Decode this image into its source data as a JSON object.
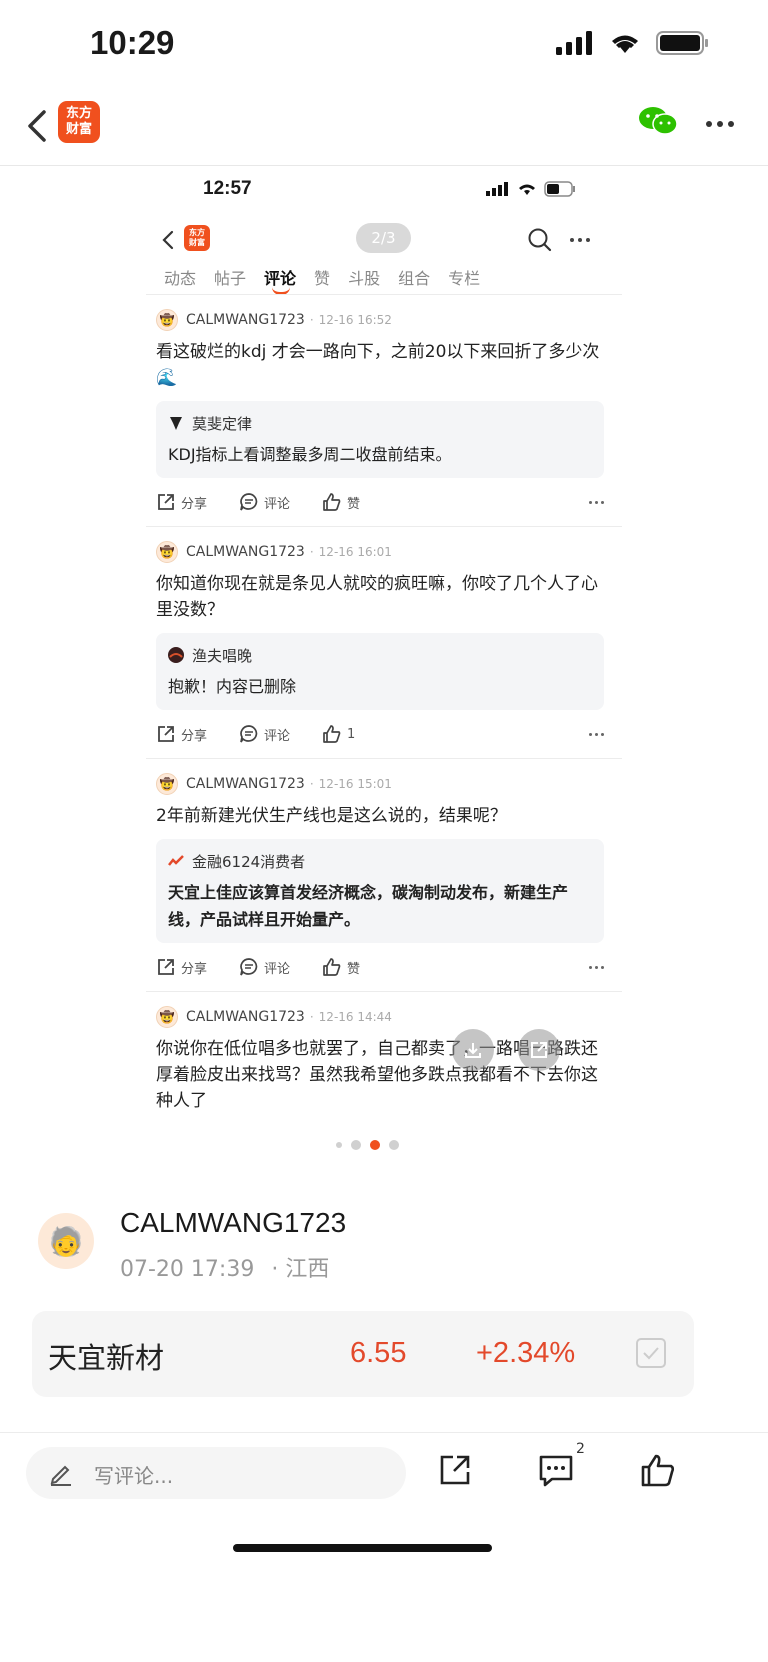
{
  "status_bar": {
    "time": "10:29"
  },
  "nav": {
    "logo_text": "东方\n财富"
  },
  "screenshot": {
    "status_time": "12:57",
    "page_indicator": "2/3",
    "tabs": [
      "动态",
      "帖子",
      "评论",
      "赞",
      "斗股",
      "组合",
      "专栏"
    ],
    "active_tab": "评论",
    "posts": [
      {
        "user": "CALMWANG1723",
        "time": "12-16 16:52",
        "text": "看这破烂的kdj 才会一路向下，之前20以下来回折了多少次🌊",
        "quote_user": "莫斐定律",
        "quote_text": "KDJ指标上看调整最多周二收盘前结束。",
        "share": "分享",
        "comment": "评论",
        "like": "赞"
      },
      {
        "user": "CALMWANG1723",
        "time": "12-16 16:01",
        "text": "你知道你现在就是条见人就咬的疯旺嘛，你咬了几个人了心里没数？",
        "quote_user": "渔夫唱晚",
        "quote_text": "抱歉！内容已删除",
        "share": "分享",
        "comment": "评论",
        "like": "1"
      },
      {
        "user": "CALMWANG1723",
        "time": "12-16 15:01",
        "text": "2年前新建光伏生产线也是这么说的，结果呢？",
        "quote_user": "金融6124消费者",
        "quote_text": "天宜上佳应该算首发经济概念，碳淘制动发布，新建生产线，产品试样且开始量产。",
        "share": "分享",
        "comment": "评论",
        "like": "赞"
      },
      {
        "user": "CALMWANG1723",
        "time": "12-16 14:44",
        "text": "你说你在低位唱多也就罢了，自己都卖了，一路唱一路跌还厚着脸皮出来找骂？虽然我希望他多跌点我都看不下去你这种人了"
      }
    ]
  },
  "carousel": {
    "count": 4,
    "active": 2
  },
  "author": {
    "name": "CALMWANG1723",
    "datetime": "07-20 17:39",
    "location": "· 江西"
  },
  "stock": {
    "name": "天宜新材",
    "price": "6.55",
    "change": "+2.34%"
  },
  "bottom_bar": {
    "comment_placeholder": "写评论...",
    "comment_count": "2"
  },
  "colors": {
    "accent": "#f0501e",
    "up": "#e3492b"
  }
}
